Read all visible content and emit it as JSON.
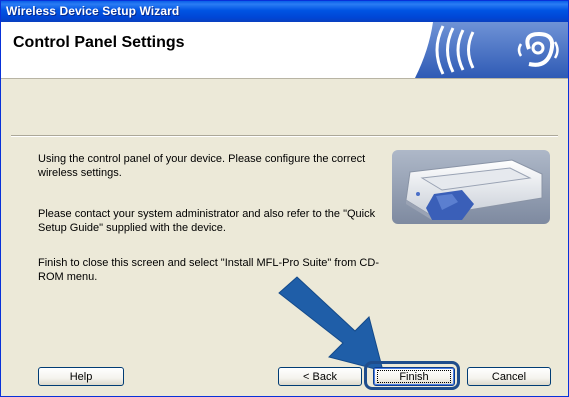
{
  "window": {
    "title": "Wireless Device Setup Wizard"
  },
  "header": {
    "title": "Control Panel Settings",
    "logo_icon": "wireless-signal-icon"
  },
  "content": {
    "message1": "Using the control panel of your device. Please configure the correct wireless settings.",
    "message2": "Please contact your system administrator and also refer to the \"Quick Setup Guide\" supplied with the device.",
    "message3": "Finish to close this screen and select \"Install MFL-Pro Suite\" from CD-ROM menu.",
    "image_icon": "printer-illustration",
    "pointer_icon": "arrow-pointer-icon"
  },
  "buttons": {
    "help": "Help",
    "back": "< Back",
    "finish": "Finish",
    "cancel": "Cancel"
  },
  "colors": {
    "titlebar": "#0054e3",
    "background": "#ece9d8",
    "accent_arrow": "#1f5ea8"
  }
}
